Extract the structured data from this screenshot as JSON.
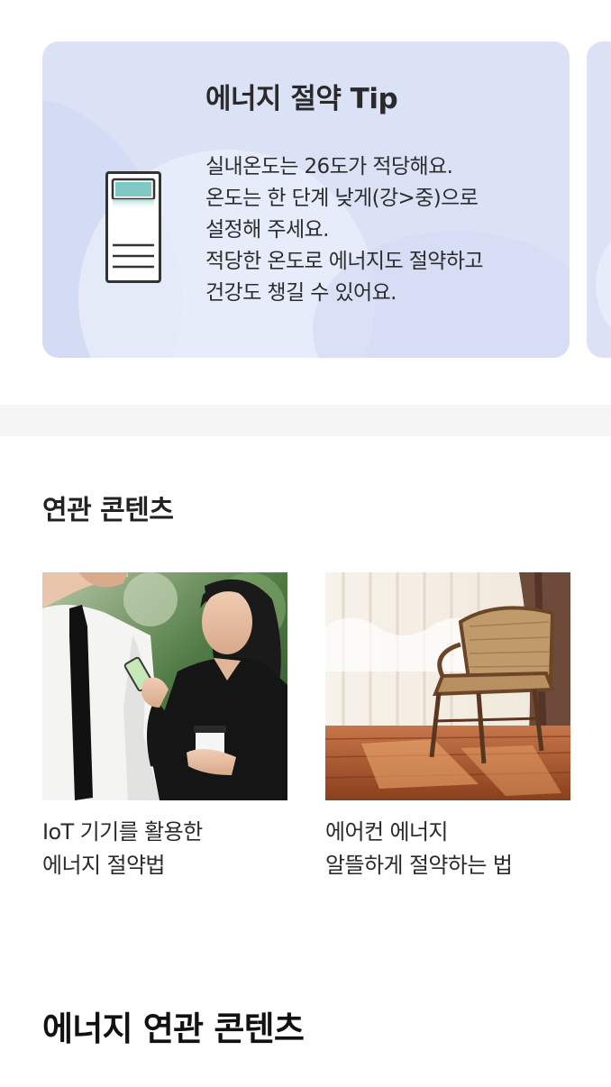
{
  "energy_tip": {
    "title": "에너지 절약 Tip",
    "icon": "air-conditioner-icon",
    "lines": [
      "실내온도는 26도가 적당해요.",
      "온도는 한 단계 낮게(강>중)으로",
      "설정해 주세요.",
      "적당한 온도로 에너지도 절약하고",
      "건강도 챙길 수 있어요."
    ],
    "card_color": "#dce2f6"
  },
  "related_contents": {
    "title": "연관 콘텐츠",
    "items": [
      {
        "image": "people-using-smartphone-photo",
        "caption_lines": [
          "IoT 기기를 활용한",
          "에너지 절약법"
        ]
      },
      {
        "image": "rattan-chair-by-window-photo",
        "caption_lines": [
          "에어컨 에너지",
          "알뜰하게 절약하는 법"
        ]
      }
    ]
  },
  "energy_related_contents": {
    "title": "에너지 연관 콘텐츠"
  }
}
